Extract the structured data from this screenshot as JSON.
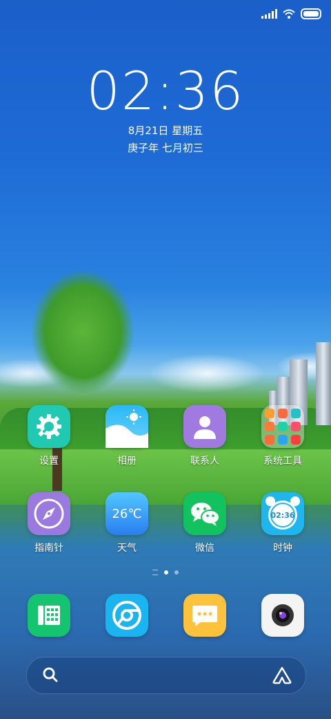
{
  "status_bar": {
    "icons": [
      "signal-icon",
      "wifi-icon",
      "battery-icon"
    ]
  },
  "lock_clock": {
    "time": "02:36",
    "date": "8月21日 星期五",
    "lunar": "庚子年 七月初三"
  },
  "apps": [
    {
      "label": "设置",
      "icon": "gear-wrench-icon",
      "color": "#1fc9b2"
    },
    {
      "label": "相册",
      "icon": "gallery-icon",
      "color": "#29b6f6"
    },
    {
      "label": "联系人",
      "icon": "contact-icon",
      "color": "#a07ae0"
    },
    {
      "label": "系统工具",
      "icon": "folder-icon",
      "color": "#ffffff"
    },
    {
      "label": "指南针",
      "icon": "compass-icon",
      "color": "#9b7ae0"
    },
    {
      "label": "天气",
      "icon": "weather-icon",
      "color": "#3a8ff0",
      "temp": "26℃"
    },
    {
      "label": "微信",
      "icon": "wechat-icon",
      "color": "#11c25e"
    },
    {
      "label": "时钟",
      "icon": "alarm-clock-icon",
      "color": "#1fb6f0",
      "time": "02:36"
    }
  ],
  "page_indicator": {
    "pages": 2,
    "current": 1
  },
  "dock": [
    {
      "name": "phone",
      "icon": "phone-icon",
      "color": "#14c46f"
    },
    {
      "name": "browser",
      "icon": "browser-icon",
      "color": "#1ab4f0"
    },
    {
      "name": "messages",
      "icon": "message-icon",
      "color": "#ffc23a"
    },
    {
      "name": "camera",
      "icon": "camera-icon",
      "color": "#ffffff"
    }
  ],
  "search_bar": {
    "left_icon": "search-icon",
    "right_icon": "assistant-icon"
  }
}
